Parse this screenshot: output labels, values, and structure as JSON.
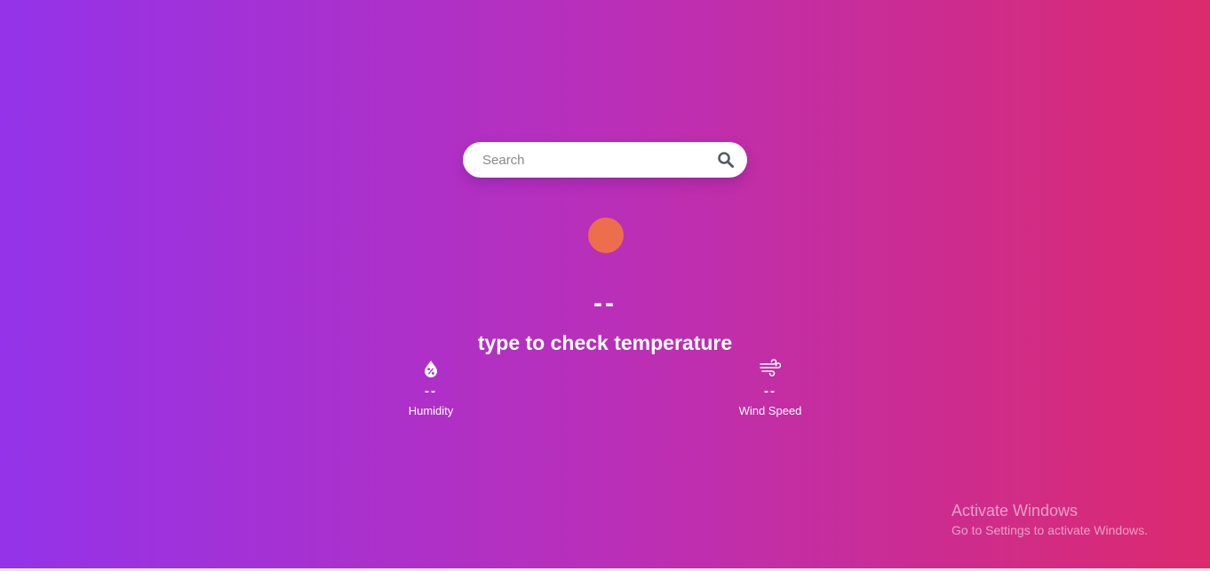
{
  "search": {
    "placeholder": "Search",
    "value": "",
    "button_icon": "search-icon"
  },
  "weather": {
    "icon": "weather-condition-icon",
    "icon_color": "#ed6e4c",
    "temperature": "--",
    "description": "type to check temperature"
  },
  "details": {
    "humidity": {
      "icon": "humidity-icon",
      "value": "--",
      "label": "Humidity"
    },
    "wind": {
      "icon": "wind-icon",
      "value": "--",
      "label": "Wind Speed"
    }
  },
  "watermark": {
    "title": "Activate Windows",
    "subtitle": "Go to Settings to activate Windows."
  },
  "colors": {
    "gradient_start": "#9433e9",
    "gradient_mid": "#b92fb9",
    "gradient_end": "#dc2a6e"
  }
}
